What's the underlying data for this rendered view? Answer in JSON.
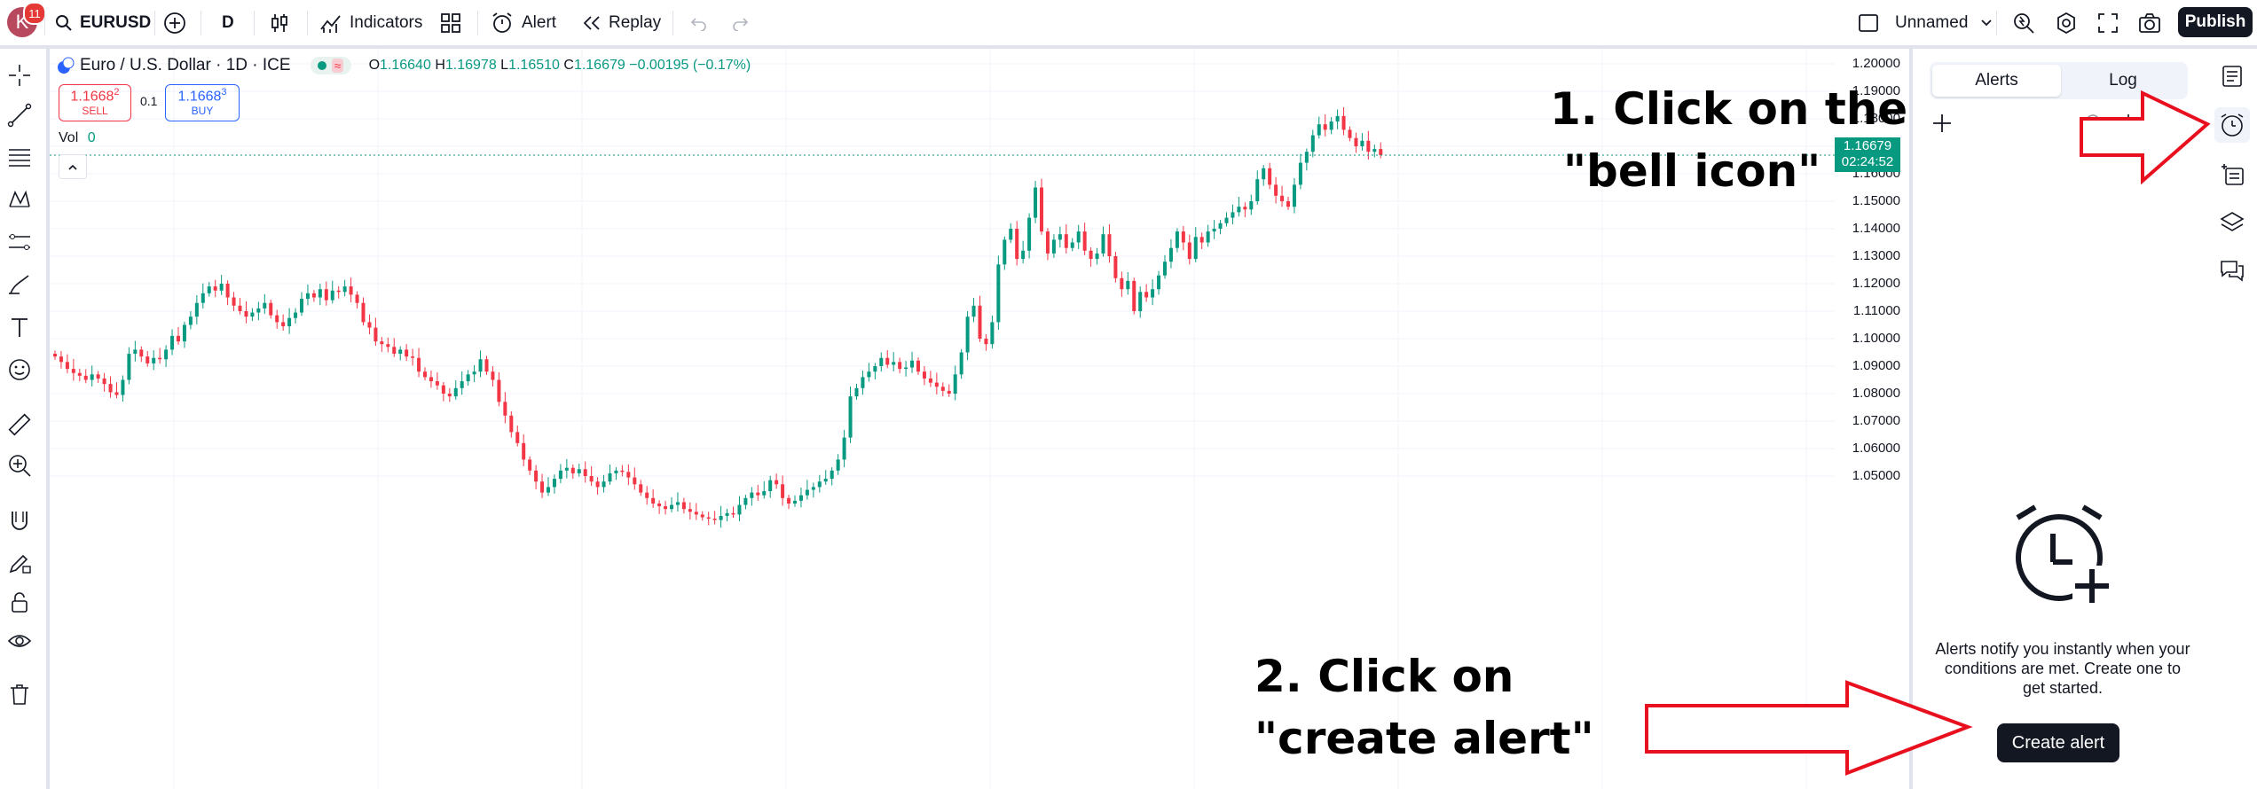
{
  "topbar": {
    "avatar_letter": "K",
    "notification_count": "11",
    "symbol": "EURUSD",
    "interval": "D",
    "indicators_label": "Indicators",
    "alert_label": "Alert",
    "replay_label": "Replay",
    "layout_name": "Unnamed",
    "publish_label": "Publish"
  },
  "legend": {
    "title": "Euro / U.S. Dollar · 1D · ICE",
    "open_label": "O",
    "open": "1.16640",
    "high_label": "H",
    "high": "1.16978",
    "low_label": "L",
    "low": "1.16510",
    "close_label": "C",
    "close": "1.16679",
    "change": "−0.00195 (−0.17%)",
    "sell_price": "1.1668",
    "sell_price_sup": "2",
    "sell_label": "SELL",
    "spread": "0.1",
    "buy_price": "1.1668",
    "buy_price_sup": "3",
    "buy_label": "BUY",
    "vol_label": "Vol",
    "vol_value": "0"
  },
  "price_axis": {
    "labels": [
      "1.20000",
      "1.19000",
      "1.18000",
      "1.17000",
      "1.16000",
      "1.15000",
      "1.14000",
      "1.13000",
      "1.12000",
      "1.11000",
      "1.10000",
      "1.09000",
      "1.08000",
      "1.07000",
      "1.06000",
      "1.05000"
    ],
    "last_price": "1.16679",
    "countdown": "02:24:52"
  },
  "alerts_panel": {
    "tab_alerts": "Alerts",
    "tab_log": "Log",
    "empty_text": "Alerts notify you instantly when your conditions are met. Create one to get started.",
    "create_button": "Create alert"
  },
  "annotations": {
    "step1_line1": "1. Click on the",
    "step1_line2": "\"bell icon\"",
    "step2_line1": "2. Click on",
    "step2_line2": "\"create alert\""
  },
  "colors": {
    "up": "#089981",
    "down": "#f23645",
    "accent": "#2962ff",
    "annotation_arrow": "#e8101e"
  },
  "chart_data": {
    "type": "candlestick",
    "symbol": "EURUSD",
    "interval": "1D",
    "ylim": [
      1.045,
      1.203
    ],
    "closes": [
      1.0935,
      1.0915,
      1.089,
      1.0875,
      1.0865,
      1.085,
      1.087,
      1.0855,
      1.0835,
      1.0805,
      1.0795,
      1.085,
      1.0945,
      1.096,
      1.0935,
      1.091,
      1.093,
      1.0925,
      1.096,
      1.101,
      1.099,
      1.105,
      1.108,
      1.113,
      1.1165,
      1.119,
      1.1175,
      1.12,
      1.115,
      1.112,
      1.11,
      1.108,
      1.1095,
      1.111,
      1.113,
      1.1085,
      1.106,
      1.1045,
      1.1075,
      1.1095,
      1.1145,
      1.1165,
      1.115,
      1.118,
      1.114,
      1.1175,
      1.117,
      1.119,
      1.116,
      1.113,
      1.106,
      1.104,
      1.099,
      1.098,
      1.097,
      1.0945,
      1.096,
      1.0935,
      1.093,
      1.088,
      1.086,
      1.0845,
      1.083,
      1.08,
      1.079,
      1.082,
      1.0845,
      1.087,
      1.088,
      1.0925,
      1.088,
      1.085,
      1.077,
      1.072,
      1.066,
      1.062,
      1.056,
      1.052,
      1.048,
      1.044,
      1.046,
      1.049,
      1.052,
      1.053,
      1.051,
      1.0525,
      1.05,
      1.048,
      1.046,
      1.048,
      1.051,
      1.052,
      1.0515,
      1.0495,
      1.047,
      1.044,
      1.042,
      1.04,
      1.039,
      1.038,
      1.0395,
      1.0405,
      1.038,
      1.037,
      1.036,
      1.035,
      1.0345,
      1.034,
      1.0355,
      1.0365,
      1.036,
      1.0395,
      1.042,
      1.044,
      1.043,
      1.0445,
      1.0485,
      1.047,
      1.042,
      1.04,
      1.041,
      1.043,
      1.045,
      1.046,
      1.048,
      1.049,
      1.052,
      1.056,
      1.064,
      1.079,
      1.082,
      1.086,
      1.088,
      1.09,
      1.093,
      1.0905,
      1.0915,
      1.089,
      1.0895,
      1.092,
      1.088,
      1.0855,
      1.084,
      1.0825,
      1.081,
      1.08,
      1.087,
      1.095,
      1.108,
      1.112,
      1.1,
      1.098,
      1.106,
      1.127,
      1.136,
      1.14,
      1.129,
      1.132,
      1.144,
      1.155,
      1.139,
      1.131,
      1.136,
      1.138,
      1.133,
      1.135,
      1.139,
      1.132,
      1.129,
      1.131,
      1.138,
      1.13,
      1.122,
      1.118,
      1.121,
      1.11,
      1.117,
      1.115,
      1.118,
      1.123,
      1.128,
      1.133,
      1.139,
      1.135,
      1.129,
      1.137,
      1.135,
      1.139,
      1.14,
      1.142,
      1.144,
      1.146,
      1.148,
      1.147,
      1.15,
      1.158,
      1.162,
      1.156,
      1.152,
      1.15,
      1.148,
      1.156,
      1.164,
      1.168,
      1.174,
      1.178,
      1.176,
      1.179,
      1.181,
      1.176,
      1.173,
      1.17,
      1.172,
      1.168,
      1.169,
      1.1668
    ]
  }
}
